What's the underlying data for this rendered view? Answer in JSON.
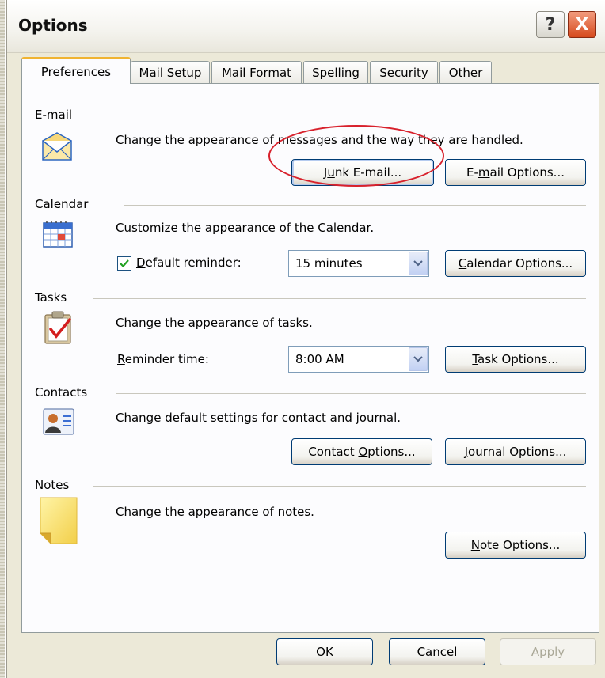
{
  "window": {
    "title": "Options",
    "help_glyph": "?",
    "close_glyph": "X"
  },
  "tabs": [
    {
      "label": "Preferences",
      "active": true
    },
    {
      "label": "Mail Setup"
    },
    {
      "label": "Mail Format"
    },
    {
      "label": "Spelling"
    },
    {
      "label": "Security"
    },
    {
      "label": "Other"
    }
  ],
  "email": {
    "heading": "E-mail",
    "description": "Change the appearance of messages and the way they are handled.",
    "junk_button": {
      "pre": "J",
      "key": "u",
      "post": "nk E-mail..."
    },
    "options_button": {
      "pre": "E-",
      "key": "m",
      "post": "ail Options..."
    }
  },
  "calendar": {
    "heading": "Calendar",
    "description": "Customize the appearance of the Calendar.",
    "reminder_checked": true,
    "reminder_label": {
      "key": "D",
      "post": "efault reminder:"
    },
    "reminder_value": "15 minutes",
    "options_button": {
      "key": "C",
      "post": "alendar Options..."
    }
  },
  "tasks": {
    "heading": "Tasks",
    "description": "Change the appearance of tasks.",
    "reminder_label": {
      "key": "R",
      "post": "eminder time:"
    },
    "reminder_value": "8:00 AM",
    "options_button": {
      "key": "T",
      "post": "ask Options..."
    }
  },
  "contacts": {
    "heading": "Contacts",
    "description": "Change default settings for contact and journal.",
    "contact_button": {
      "pre": "Contact ",
      "key": "O",
      "post": "ptions..."
    },
    "journal_button": {
      "key": "J",
      "post": "ournal Options..."
    }
  },
  "notes": {
    "heading": "Notes",
    "description": "Change the appearance of notes.",
    "options_button": {
      "key": "N",
      "post": "ote Options..."
    }
  },
  "footer": {
    "ok": "OK",
    "cancel": "Cancel",
    "apply": "Apply"
  },
  "colors": {
    "annotation_ring": "#d8212c",
    "active_tab_accent": "#f0b432"
  },
  "icons": [
    "envelope-icon",
    "calendar-icon",
    "task-icon",
    "contact-card-icon",
    "note-icon",
    "help-icon",
    "close-icon",
    "dropdown-arrow-icon",
    "checkmark-icon"
  ]
}
